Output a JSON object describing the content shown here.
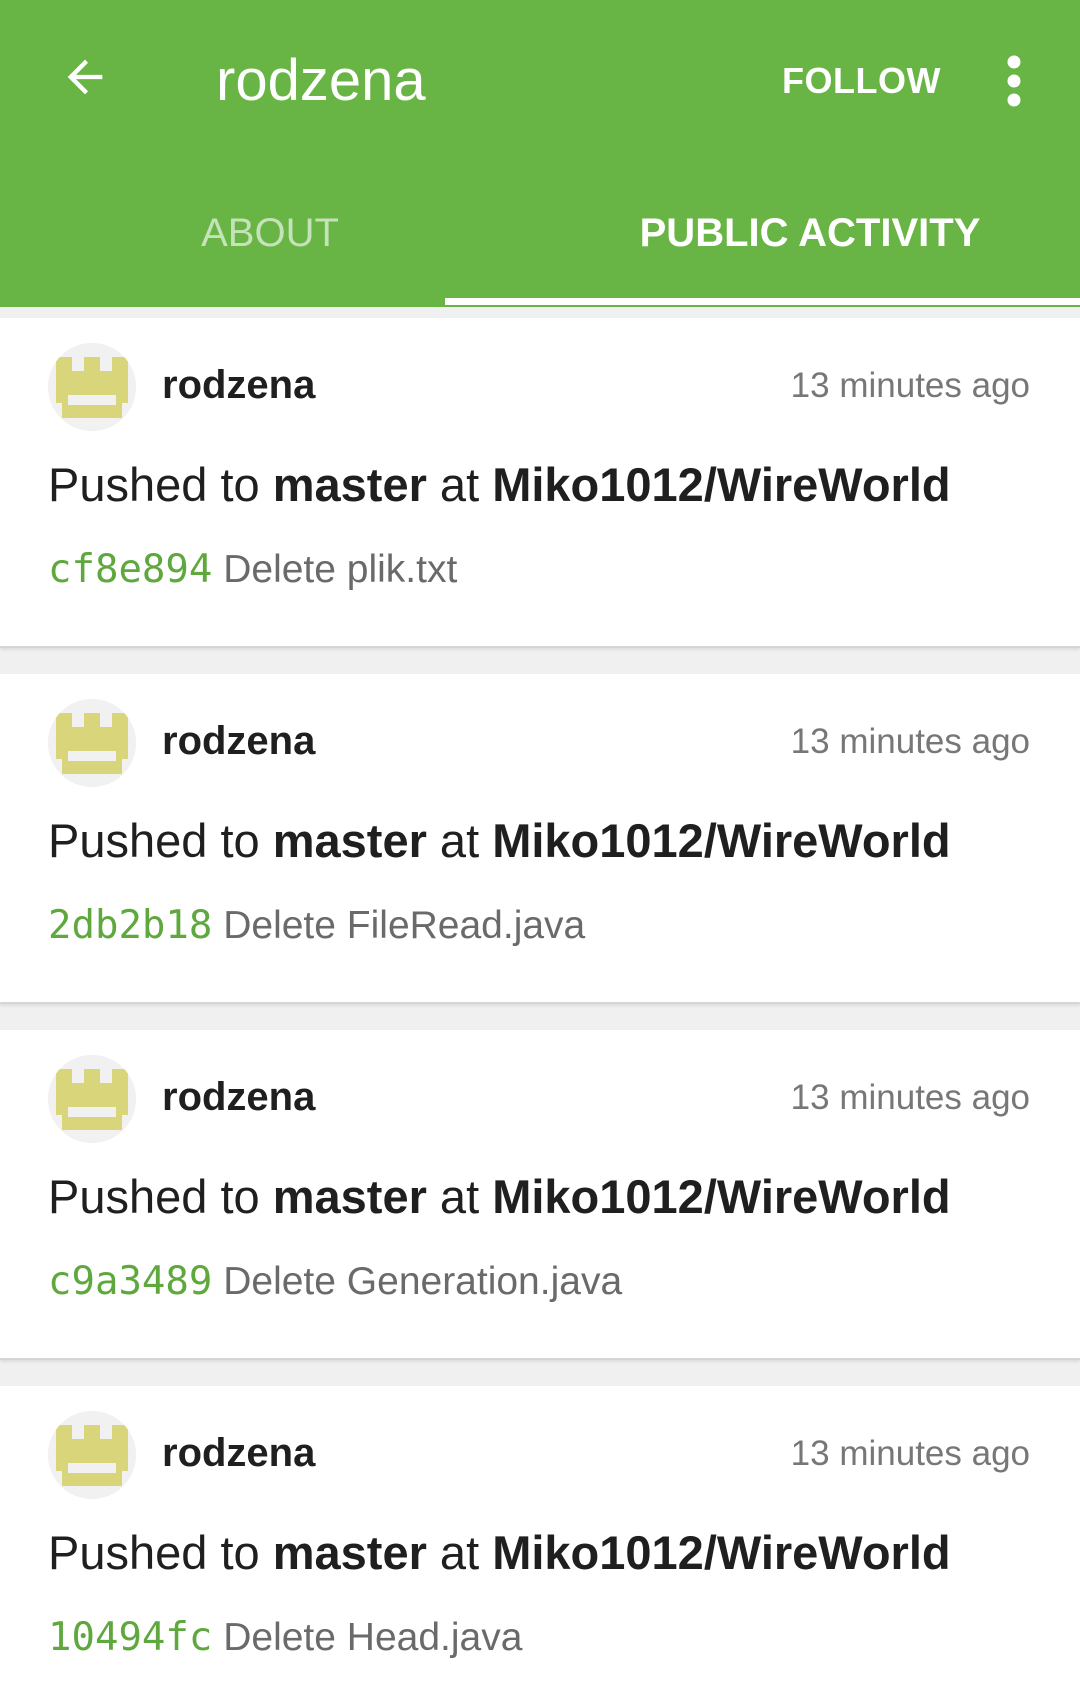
{
  "app_bar": {
    "title": "rodzena",
    "follow_label": "FOLLOW",
    "back_icon": "arrow-back-icon",
    "more_icon": "more-vert-icon",
    "color": "#68b445"
  },
  "tabs": [
    {
      "label": "ABOUT",
      "active": false
    },
    {
      "label": "PUBLIC ACTIVITY",
      "active": true
    }
  ],
  "events": [
    {
      "user": "rodzena",
      "time": "13 minutes ago",
      "action_prefix": "Pushed to ",
      "branch": "master",
      "action_mid": " at ",
      "repo": "Miko1012/WireWorld",
      "sha": "cf8e894",
      "message": "Delete plik.txt"
    },
    {
      "user": "rodzena",
      "time": "13 minutes ago",
      "action_prefix": "Pushed to ",
      "branch": "master",
      "action_mid": " at ",
      "repo": "Miko1012/WireWorld",
      "sha": "2db2b18",
      "message": "Delete FileRead.java"
    },
    {
      "user": "rodzena",
      "time": "13 minutes ago",
      "action_prefix": "Pushed to ",
      "branch": "master",
      "action_mid": " at ",
      "repo": "Miko1012/WireWorld",
      "sha": "c9a3489",
      "message": "Delete Generation.java"
    },
    {
      "user": "rodzena",
      "time": "13 minutes ago",
      "action_prefix": "Pushed to ",
      "branch": "master",
      "action_mid": " at ",
      "repo": "Miko1012/WireWorld",
      "sha": "10494fc",
      "message": "Delete Head.java"
    }
  ]
}
